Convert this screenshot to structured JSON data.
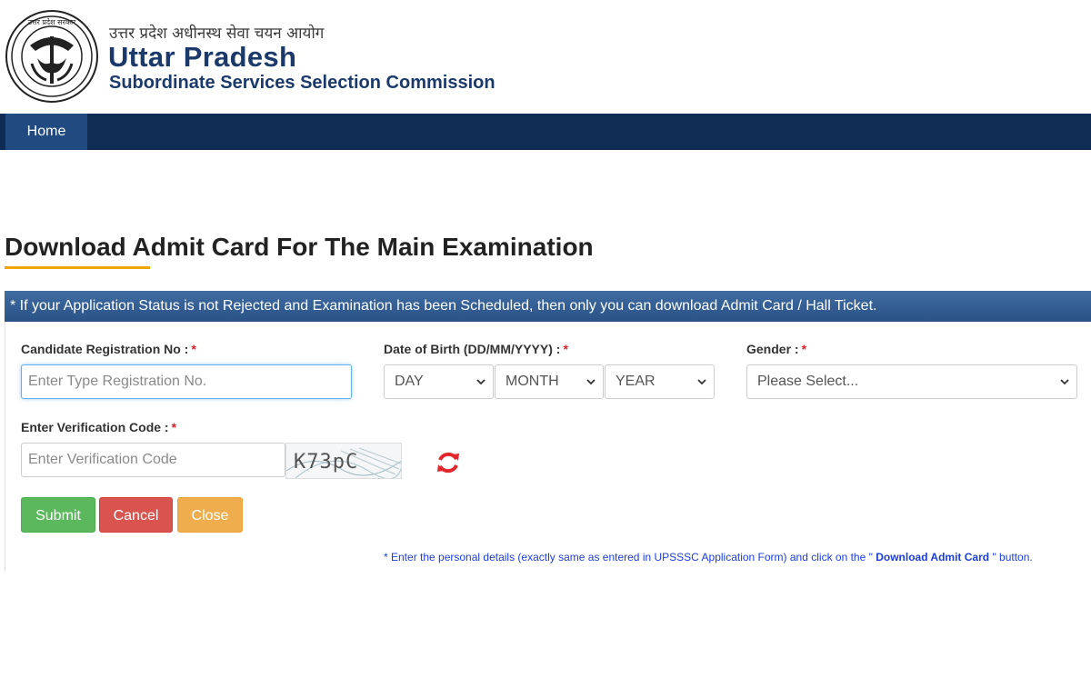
{
  "header": {
    "hindi_title": "उत्तर प्रदेश अधीनस्थ सेवा चयन आयोग",
    "state": "Uttar Pradesh",
    "commission": "Subordinate Services Selection Commission",
    "logo_icon": "up-state-emblem-icon",
    "logo_text": "उत्तर प्रदेश सरकार"
  },
  "nav": {
    "home": "Home"
  },
  "page": {
    "title": "Download Admit Card For The Main Examination",
    "notice": "* If your Application Status is not Rejected and Examination has been Scheduled, then only you can download Admit Card / Hall Ticket."
  },
  "form": {
    "registration": {
      "label": "Candidate Registration No :",
      "placeholder": "Enter Type Registration No."
    },
    "dob": {
      "label": "Date of Birth (DD/MM/YYYY) :",
      "day": "DAY",
      "month": "MONTH",
      "year": "YEAR"
    },
    "gender": {
      "label": "Gender :",
      "value": "Please Select..."
    },
    "verification": {
      "label": "Enter Verification Code :",
      "placeholder": "Enter Verification Code",
      "captcha": "K73pC"
    },
    "required_mark": "*",
    "buttons": {
      "submit": "Submit",
      "cancel": "Cancel",
      "close": "Close"
    },
    "footnote_pre": "* Enter the personal details (exactly same as entered in UPSSSC Application Form) and click on the \"",
    "footnote_bold": "Download Admit Card",
    "footnote_post": "\" button."
  },
  "colors": {
    "nav": "#0f2d54",
    "brand_text": "#1b3a6b",
    "notice": "#2f5a8f",
    "accent_underline": "#f0a500",
    "submit": "#5cb85c",
    "cancel": "#d9534f",
    "close": "#f0ad4e",
    "refresh": "#e3262b"
  }
}
